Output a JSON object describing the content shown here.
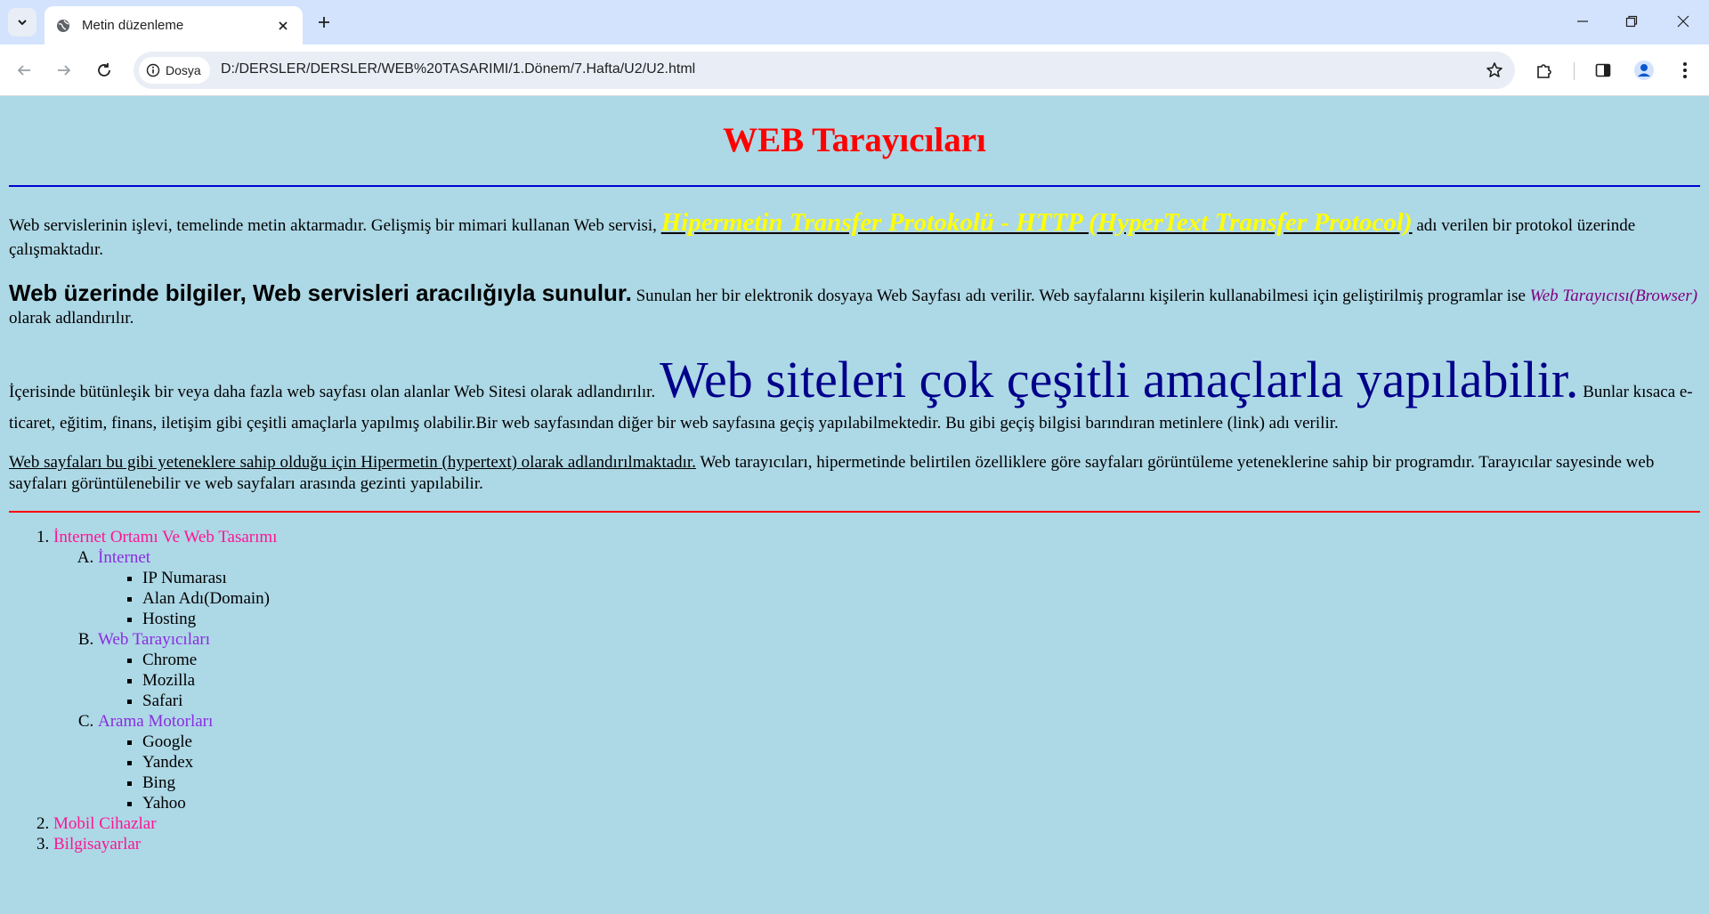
{
  "browser": {
    "tab_title": "Metin düzenleme",
    "security_label": "Dosya",
    "url": "D:/DERSLER/DERSLER/WEB%20TASARIMI/1.Dönem/7.Hafta/U2/U2.html"
  },
  "page": {
    "heading": "WEB Tarayıcıları",
    "p1_text_a": "Web servislerinin işlevi, temelinde metin aktarmadır. Gelişmiş bir mimari kullanan Web servisi, ",
    "p1_http": "Hipermetin Transfer Protokolü - HTTP (HyperText Transfer Protocol)",
    "p1_text_b": " adı verilen bir protokol üzerinde çalışmaktadır.",
    "p2_bold": "Web üzerinde bilgiler, Web servisleri aracılığıyla sunulur.",
    "p2_text_a": " Sunulan her bir elektronik dosyaya Web Sayfası adı verilir. Web sayfalarını kişilerin kullanabilmesi için geliştirilmiş programlar ise ",
    "p2_italic": "Web Tarayıcısı(Browser)",
    "p2_text_b": " olarak adlandırılır.",
    "p3_text_a": "İçerisinde bütünleşik bir veya daha fazla web sayfası olan alanlar Web Sitesi olarak adlandırılır. ",
    "p3_big": "Web siteleri çok çeşitli amaçlarla yapılabilir.",
    "p3_text_b": " Bunlar kısaca e-ticaret, eğitim, finans, iletişim gibi çeşitli amaçlarla yapılmış olabilir.Bir web sayfasından diğer bir web sayfasına geçiş yapılabilmektedir. Bu gibi geçiş bilgisi barındıran metinlere (link) adı verilir.",
    "p4_underline": "Web sayfaları bu gibi yeteneklere sahip olduğu için Hipermetin (hypertext) olarak adlandırılmaktadır.",
    "p4_text": " Web tarayıcıları, hipermetinde belirtilen özelliklere göre sayfaları görüntüleme yeteneklerine sahip bir programdır. Tarayıcılar sayesinde web sayfaları görüntülenebilir ve web sayfaları arasında gezinti yapılabilir."
  },
  "list": {
    "item1": "İnternet Ortamı Ve Web Tasarımı",
    "sub_a": "İnternet",
    "sub_a_items": [
      "IP Numarası",
      "Alan Adı(Domain)",
      "Hosting"
    ],
    "sub_b": "Web Tarayıcıları",
    "sub_b_items": [
      "Chrome",
      "Mozilla",
      "Safari"
    ],
    "sub_c": "Arama Motorları",
    "sub_c_items": [
      "Google",
      "Yandex",
      "Bing",
      "Yahoo"
    ],
    "item2": "Mobil Cihazlar",
    "item3": "Bilgisayarlar"
  },
  "colors": {
    "page_bg": "#add8e6",
    "heading": "#ff0000",
    "http_link": "#ffff00",
    "big_text": "#00008b",
    "list_top": "#ff1493",
    "list_sub": "#8a2be2"
  }
}
